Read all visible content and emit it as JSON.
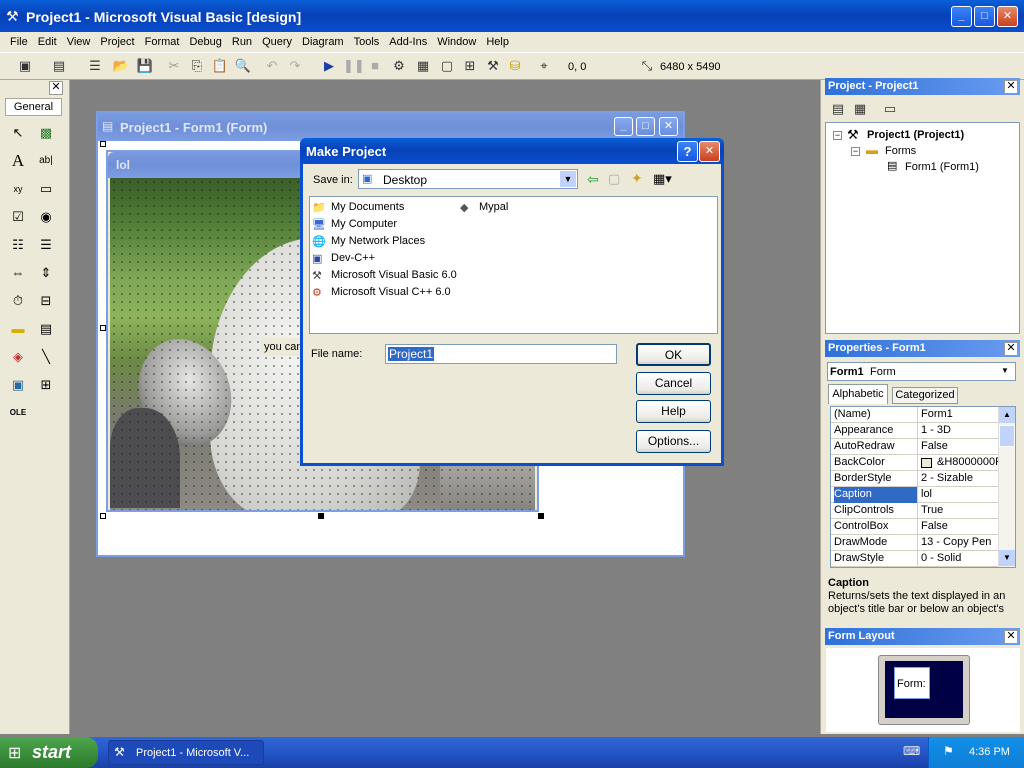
{
  "app": {
    "title": "Project1 - Microsoft Visual Basic [design]",
    "menu": [
      "File",
      "Edit",
      "View",
      "Project",
      "Format",
      "Debug",
      "Run",
      "Query",
      "Diagram",
      "Tools",
      "Add-Ins",
      "Window",
      "Help"
    ],
    "toolbar": {
      "position": "0, 0",
      "size": "6480 x 5490"
    }
  },
  "toolbox": {
    "tab_label": "General"
  },
  "form_window": {
    "title": "Project1 - Form1 (Form)",
    "form_caption": "lol",
    "label_text": "you can"
  },
  "dialog": {
    "title": "Make Project",
    "save_in_label": "Save in:",
    "save_in_value": "Desktop",
    "files": [
      {
        "name": "My Documents",
        "icon": "folder-docs-icon"
      },
      {
        "name": "My Computer",
        "icon": "computer-icon"
      },
      {
        "name": "My Network Places",
        "icon": "network-icon"
      },
      {
        "name": "Dev-C++",
        "icon": "shortcut-icon"
      },
      {
        "name": "Microsoft Visual Basic 6.0",
        "icon": "vb-icon"
      },
      {
        "name": "Microsoft Visual C++ 6.0",
        "icon": "vc-icon"
      }
    ],
    "files_col2": [
      {
        "name": "Mypal",
        "icon": "mypal-icon"
      }
    ],
    "filename_label": "File name:",
    "filename_value": "Project1",
    "buttons": {
      "ok": "OK",
      "cancel": "Cancel",
      "help": "Help",
      "options": "Options..."
    }
  },
  "project": {
    "title": "Project - Project1",
    "root": "Project1 (Project1)",
    "folder": "Forms",
    "form": "Form1 (Form1)"
  },
  "properties": {
    "title": "Properties - Form1",
    "object_name": "Form1",
    "object_type": "Form",
    "tabs": [
      "Alphabetic",
      "Categorized"
    ],
    "rows": [
      {
        "k": "(Name)",
        "v": "Form1"
      },
      {
        "k": "Appearance",
        "v": "1 - 3D"
      },
      {
        "k": "AutoRedraw",
        "v": "False"
      },
      {
        "k": "BackColor",
        "v": "&H8000000F"
      },
      {
        "k": "BorderStyle",
        "v": "2 - Sizable"
      },
      {
        "k": "Caption",
        "v": "lol"
      },
      {
        "k": "ClipControls",
        "v": "True"
      },
      {
        "k": "ControlBox",
        "v": "False"
      },
      {
        "k": "DrawMode",
        "v": "13 - Copy Pen"
      },
      {
        "k": "DrawStyle",
        "v": "0 - Solid"
      }
    ],
    "desc_title": "Caption",
    "desc_text": "Returns/sets the text displayed in an object's title bar or below an object's"
  },
  "form_layout": {
    "title": "Form Layout",
    "thumb_label": "Form:"
  },
  "taskbar": {
    "start": "start",
    "task": "Project1 - Microsoft V...",
    "clock": "4:36 PM"
  }
}
